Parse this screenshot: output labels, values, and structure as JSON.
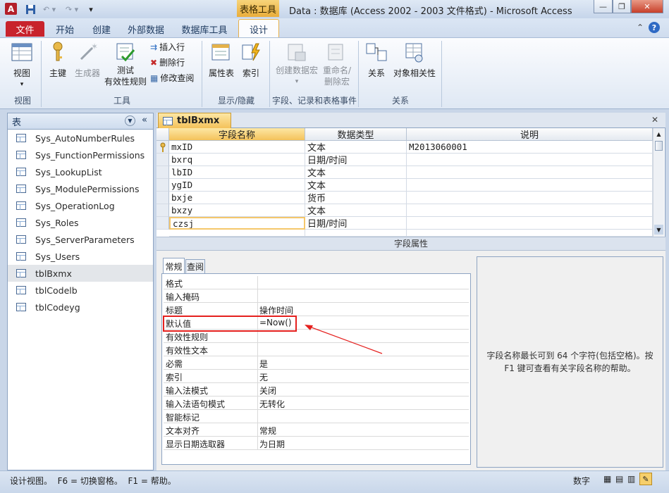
{
  "titlebar": {
    "context_tab": "表格工具",
    "title": "Data : 数据库 (Access 2002 - 2003 文件格式) - Microsoft Access"
  },
  "ribbon_tabs": {
    "file": "文件",
    "home": "开始",
    "create": "创建",
    "external": "外部数据",
    "dbtools": "数据库工具",
    "design": "设计"
  },
  "ribbon": {
    "view": "视图",
    "primary_key": "主键",
    "builder": "生成器",
    "test_rules_1": "测试",
    "test_rules_2": "有效性规则",
    "insert_rows": "插入行",
    "delete_rows": "删除行",
    "modify_lookups": "修改查阅",
    "property_sheet": "属性表",
    "indexes": "索引",
    "create_macro_1": "创建数据宏",
    "create_macro_2": "▾",
    "rename_macro_1": "重命名/",
    "rename_macro_2": "删除宏",
    "relationships": "关系",
    "object_deps": "对象相关性",
    "groups": {
      "views": "视图",
      "tools": "工具",
      "showhide": "显示/隐藏",
      "events": "字段、记录和表格事件",
      "relations": "关系"
    }
  },
  "nav": {
    "header": "表",
    "items": [
      "Sys_AutoNumberRules",
      "Sys_FunctionPermissions",
      "Sys_LookupList",
      "Sys_ModulePermissions",
      "Sys_OperationLog",
      "Sys_Roles",
      "Sys_ServerParameters",
      "Sys_Users",
      "tblBxmx",
      "tblCodelb",
      "tblCodeyg"
    ]
  },
  "doc": {
    "tab": "tblBxmx"
  },
  "grid": {
    "headers": {
      "name": "字段名称",
      "type": "数据类型",
      "desc": "说明"
    },
    "rows": [
      {
        "name": "mxID",
        "type": "文本",
        "desc": "M2013060001"
      },
      {
        "name": "bxrq",
        "type": "日期/时间",
        "desc": ""
      },
      {
        "name": "lbID",
        "type": "文本",
        "desc": ""
      },
      {
        "name": "ygID",
        "type": "文本",
        "desc": ""
      },
      {
        "name": "bxje",
        "type": "货币",
        "desc": ""
      },
      {
        "name": "bxzy",
        "type": "文本",
        "desc": ""
      },
      {
        "name": "czsj",
        "type": "日期/时间",
        "desc": ""
      }
    ]
  },
  "field_props": {
    "title": "字段属性",
    "tabs": {
      "general": "常规",
      "lookup": "查阅"
    },
    "rows": [
      {
        "label": "格式",
        "value": ""
      },
      {
        "label": "输入掩码",
        "value": ""
      },
      {
        "label": "标题",
        "value": "操作时间"
      },
      {
        "label": "默认值",
        "value": "=Now()"
      },
      {
        "label": "有效性规则",
        "value": ""
      },
      {
        "label": "有效性文本",
        "value": ""
      },
      {
        "label": "必需",
        "value": "是"
      },
      {
        "label": "索引",
        "value": "无"
      },
      {
        "label": "输入法模式",
        "value": "关闭"
      },
      {
        "label": "输入法语句模式",
        "value": "无转化"
      },
      {
        "label": "智能标记",
        "value": ""
      },
      {
        "label": "文本对齐",
        "value": "常规"
      },
      {
        "label": "显示日期选取器",
        "value": "为日期"
      }
    ],
    "help": "字段名称最长可到 64 个字符(包括空格)。按 F1 键可查看有关字段名称的帮助。"
  },
  "status": {
    "left": "设计视图。  F6 = 切换窗格。  F1 = 帮助。",
    "mode": "数字"
  },
  "colors": {
    "file_tab": "#c8232c",
    "highlight": "#e5201e",
    "selected_field": "#f5c76b"
  }
}
